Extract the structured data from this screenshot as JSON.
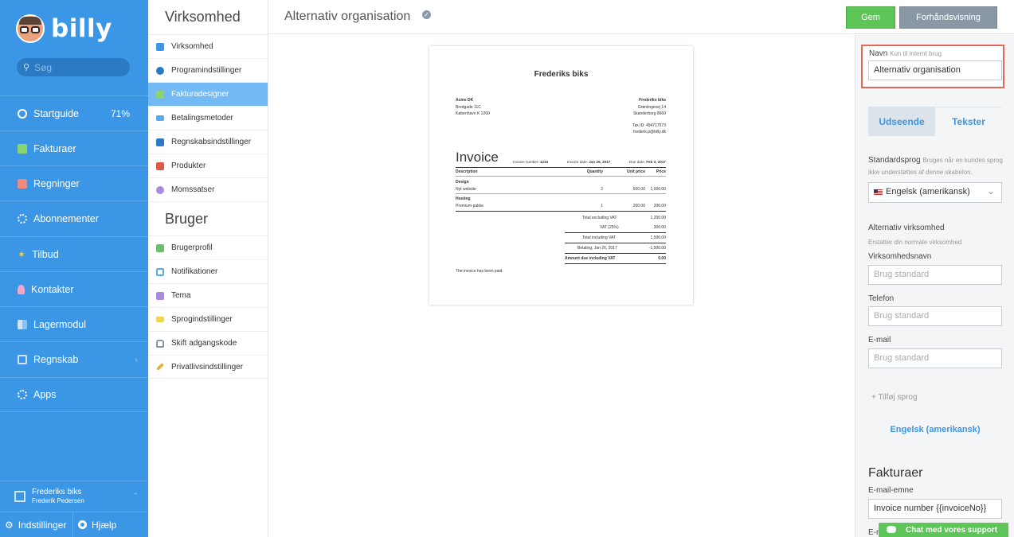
{
  "app": {
    "logo": "billy",
    "search_placeholder": "Søg"
  },
  "nav": {
    "items": [
      {
        "label": "Startguide",
        "value": "71%",
        "icon": "clock-icon"
      },
      {
        "label": "Fakturaer",
        "icon": "document-icon"
      },
      {
        "label": "Regninger",
        "icon": "receipt-icon"
      },
      {
        "label": "Abonnementer",
        "icon": "cycle-icon"
      },
      {
        "label": "Tilbud",
        "icon": "star-icon"
      },
      {
        "label": "Kontakter",
        "icon": "person-icon"
      },
      {
        "label": "Lagermodul",
        "icon": "boxes-icon"
      },
      {
        "label": "Regnskab",
        "icon": "ledger-icon"
      },
      {
        "label": "Apps",
        "icon": "apps-icon"
      }
    ],
    "org_name": "Frederiks biks",
    "user_name": "Frederik Pedersen",
    "settings": "Indstillinger",
    "help": "Hjælp"
  },
  "menu": {
    "section1": "Virksomhed",
    "items1": [
      {
        "label": "Virksomhed",
        "color": "#3b97e6"
      },
      {
        "label": "Programindstillinger",
        "color": "#2a7ac4"
      },
      {
        "label": "Fakturadesigner",
        "color": "#8bd46e"
      },
      {
        "label": "Betalingsmetoder",
        "color": "#5aa9ee"
      },
      {
        "label": "Regnskabsindstillinger",
        "color": "#2a7ac4"
      },
      {
        "label": "Produkter",
        "color": "#e0584a"
      },
      {
        "label": "Momssatser",
        "color": "#a78be0"
      }
    ],
    "section2": "Bruger",
    "items2": [
      {
        "label": "Brugerprofil",
        "color": "#6cc06a"
      },
      {
        "label": "Notifikationer",
        "color": "#5aa9ee"
      },
      {
        "label": "Tema",
        "color": "#a78be0"
      },
      {
        "label": "Sprogindstillinger",
        "color": "#f2d44a"
      },
      {
        "label": "Skift adgangskode",
        "color": "#8a98a6"
      },
      {
        "label": "Privatlivsindstillinger",
        "color": "#e8b23a"
      }
    ]
  },
  "header": {
    "title": "Alternativ organisation",
    "save": "Gem",
    "preview": "Forhåndsvisning"
  },
  "invoice": {
    "company": "Frederiks biks",
    "customer": [
      "Acme DK",
      "Bredgade 11C",
      "København K 1260"
    ],
    "sender": [
      "Frederiks biks",
      "Grønlingevej 14",
      "Skanderborg 8660"
    ],
    "tax": [
      "Tax ID: 494717573",
      "frederik.p@billy.dk"
    ],
    "title": "Invoice",
    "number_label": "Invoice number:",
    "number": "1234",
    "date_label": "Invoice date:",
    "date": "Jan 26, 2017",
    "due_label": "Due date:",
    "due": "Feb 3, 2017",
    "cols": [
      "Description",
      "Quantity",
      "Unit price",
      "Price"
    ],
    "group1": "Design",
    "row1": [
      "Nyt website",
      "2",
      "500.00",
      "1,000.00"
    ],
    "group2": "Hosting",
    "row2": [
      "Premium-pakke",
      "1",
      "200.00",
      "200.00"
    ],
    "totals": [
      [
        "Total excluding VAT",
        "1,200.00"
      ],
      [
        "VAT (25%)",
        "300.00"
      ],
      [
        "Total including VAT",
        "1,500.00"
      ],
      [
        "Betaling, Jan 26, 2017",
        "-1,500.00"
      ],
      [
        "Amount due including VAT",
        "0.00"
      ]
    ],
    "footer": "The invoice has been paid."
  },
  "panel": {
    "name_label": "Navn",
    "name_hint": "Kun til internt brug",
    "name_value": "Alternativ organisation",
    "tab1": "Udseende",
    "tab2": "Tekster",
    "lang_label": "Standardsprog",
    "lang_hint": "Bruges når en kundes sprog ikke understøttes af denne skabelon.",
    "lang_value": "Engelsk (amerikansk)",
    "alt_label": "Alternativ virksomhed",
    "alt_hint": "Erstatter din normale virksomhed",
    "company_label": "Virksomhedsnavn",
    "company_ph": "Brug standard",
    "phone_label": "Telefon",
    "phone_ph": "Brug standard",
    "email_label": "E-mail",
    "email_ph": "Brug standard",
    "add_lang": "+ Tilføj sprog",
    "lang_link": "Engelsk (amerikansk)",
    "invoices_h": "Fakturaer",
    "subject_label": "E-mail-emne",
    "subject_value": "Invoice number {{invoiceNo}}",
    "next_label": "E-m"
  },
  "chat": "Chat med vores support"
}
